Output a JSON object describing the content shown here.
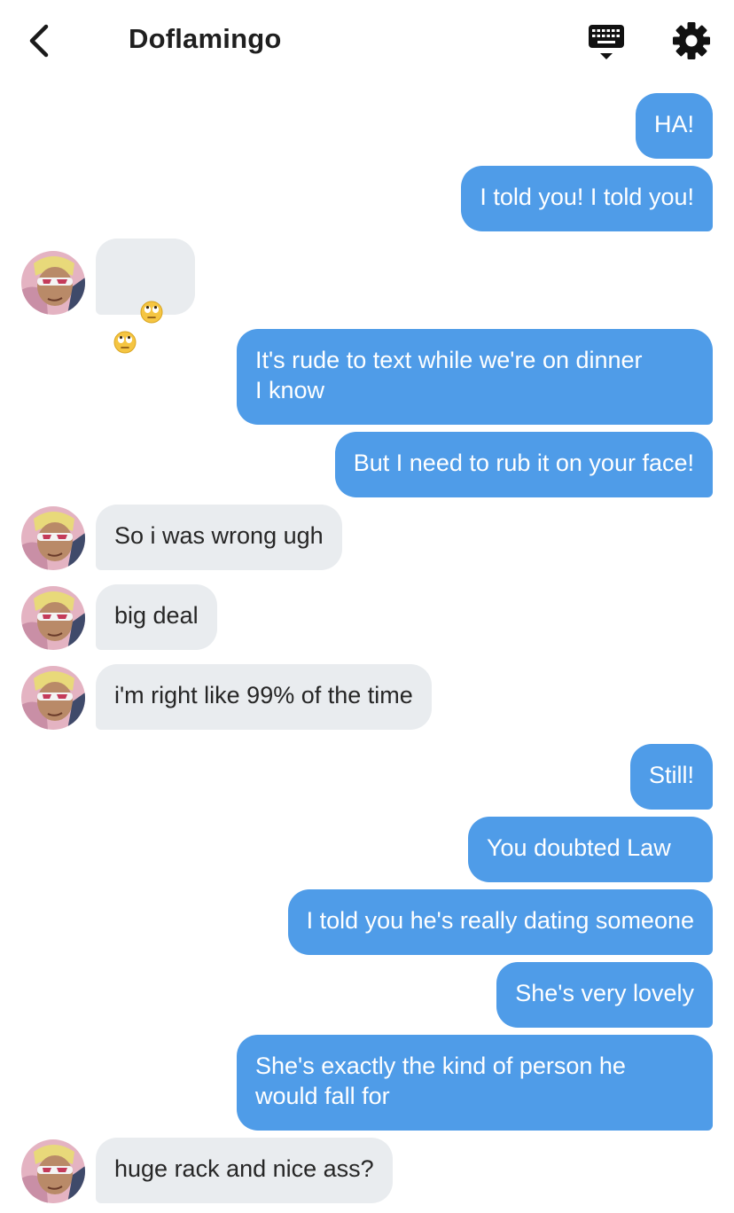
{
  "header": {
    "title": "Doflamingo",
    "back_icon": "chevron-left-icon",
    "keyboard_icon": "keyboard-icon",
    "settings_icon": "gear-icon"
  },
  "colors": {
    "outgoing_bubble": "#4f9ce8",
    "incoming_bubble": "#e9ecef",
    "outgoing_text": "#ffffff",
    "incoming_text": "#262626"
  },
  "messages": [
    {
      "side": "out",
      "text": "HA!"
    },
    {
      "side": "out",
      "text": "I told you! I told you!"
    },
    {
      "side": "in",
      "text": "🙄🙄",
      "emoji": "face-with-rolling-eyes"
    },
    {
      "side": "out",
      "text": "It's rude to text while we're on dinner\nI know"
    },
    {
      "side": "out",
      "text": "But I need to rub it on your face!"
    },
    {
      "side": "in",
      "text": "So i was wrong ugh"
    },
    {
      "side": "in",
      "text": "big deal"
    },
    {
      "side": "in",
      "text": "i'm right like 99% of the time"
    },
    {
      "side": "out",
      "text": "Still!"
    },
    {
      "side": "out",
      "text": "You doubted Law"
    },
    {
      "side": "out",
      "text": "I told you he's really dating someone"
    },
    {
      "side": "out",
      "text": "She's very lovely"
    },
    {
      "side": "out",
      "text": "She's exactly the kind of person he\nwould fall for"
    },
    {
      "side": "in",
      "text": "huge rack and nice ass?"
    }
  ]
}
